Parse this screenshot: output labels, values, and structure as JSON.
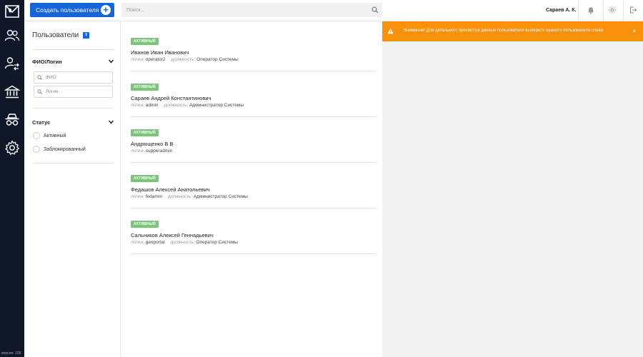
{
  "rail": {
    "logo_icon": "envelope-map-logo",
    "items": [
      {
        "name": "users-icon",
        "active": true
      },
      {
        "name": "user-switch-icon",
        "active": false
      },
      {
        "name": "bank-icon",
        "active": false
      },
      {
        "name": "spy-icon",
        "active": false
      },
      {
        "name": "gear-icon",
        "active": false
      }
    ],
    "version": "версия: 208"
  },
  "topbar": {
    "create_button_label": "Создать пользователя",
    "search_placeholder": "Поиск...",
    "user_name": "Сараев А. К."
  },
  "filters": {
    "title": "Пользователи",
    "count": "5",
    "fio_section": {
      "title": "ФИО/Логин",
      "fio_placeholder": "ФИО",
      "login_placeholder": "Логин"
    },
    "status_section": {
      "title": "Статус",
      "options": [
        "Активный",
        "Заблокированный"
      ]
    }
  },
  "users": [
    {
      "status": "АКТИВНЫЙ",
      "name": "Иванов Иван Иванович",
      "login_label": "логин:",
      "login": "operator2",
      "position_label": "должность:",
      "position": "Оператор Системы"
    },
    {
      "status": "АКТИВНЫЙ",
      "name": "Сараев Андрей Константинович",
      "login_label": "логин:",
      "login": "admin",
      "position_label": "должность:",
      "position": "Администратор Системы"
    },
    {
      "status": "АКТИВНЫЙ",
      "name": "Андрющенко В В",
      "login_label": "логин:",
      "login": "supperadmin",
      "position_label": "",
      "position": ""
    },
    {
      "status": "АКТИВНЫЙ",
      "name": "Федашов Алексей Анатольевич",
      "login_label": "логин:",
      "login": "fedamm",
      "position_label": "должность:",
      "position": "Администратор Системы"
    },
    {
      "status": "АКТИВНЫЙ",
      "name": "Сальников Алексей Геннадьевич",
      "login_label": "логин:",
      "login": "geoportal",
      "position_label": "должность:",
      "position": "Оператор Системы"
    }
  ],
  "alert": {
    "message": "Внимание! Для детального просмотра данных пользователя выберите нужного пользователя слева.",
    "close_label": "×"
  },
  "colors": {
    "rail": "#0f1728",
    "primary": "#1565d8",
    "active_badge": "#7cc47c",
    "alert": "#f7900b"
  }
}
